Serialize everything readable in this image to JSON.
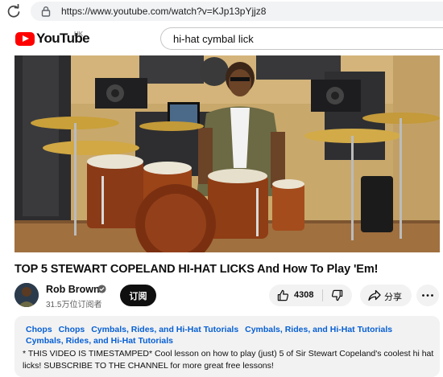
{
  "browser": {
    "url": "https://www.youtube.com/watch?v=KJp13pYjjz8"
  },
  "header": {
    "logo_text": "YouTube",
    "region": "HK",
    "search_query": "hi-hat cymbal lick"
  },
  "video": {
    "title": "TOP 5 STEWART COPELAND HI-HAT LICKS And How To Play 'Em!",
    "channel_name": "Rob Brown",
    "subscribers": "31.5万位订阅者",
    "subscribe_label": "订阅",
    "like_count": "4308",
    "share_label": "分享"
  },
  "description": {
    "tags": [
      "Chops",
      "Chops",
      "Cymbals, Rides, and Hi-Hat Tutorials",
      "Cymbals, Rides, and Hi-Hat Tutorials",
      "Cymbals, Rides, and Hi-Hat Tutorials"
    ],
    "text": "* THIS VIDEO IS TIMESTAMPED* Cool lesson on how to play (just) 5 of Sir Stewart Copeland's coolest hi hat licks! SUBSCRIBE TO THE CHANNEL for more great free lessons!"
  },
  "colors": {
    "brand_red": "#ff0000",
    "link_blue": "#065fd4",
    "subscribe_bg": "#0f0f0f"
  },
  "icons": [
    "reload-icon",
    "lock-icon",
    "youtube-logo-icon",
    "verified-icon",
    "like-icon",
    "dislike-icon",
    "share-icon",
    "more-icon"
  ]
}
